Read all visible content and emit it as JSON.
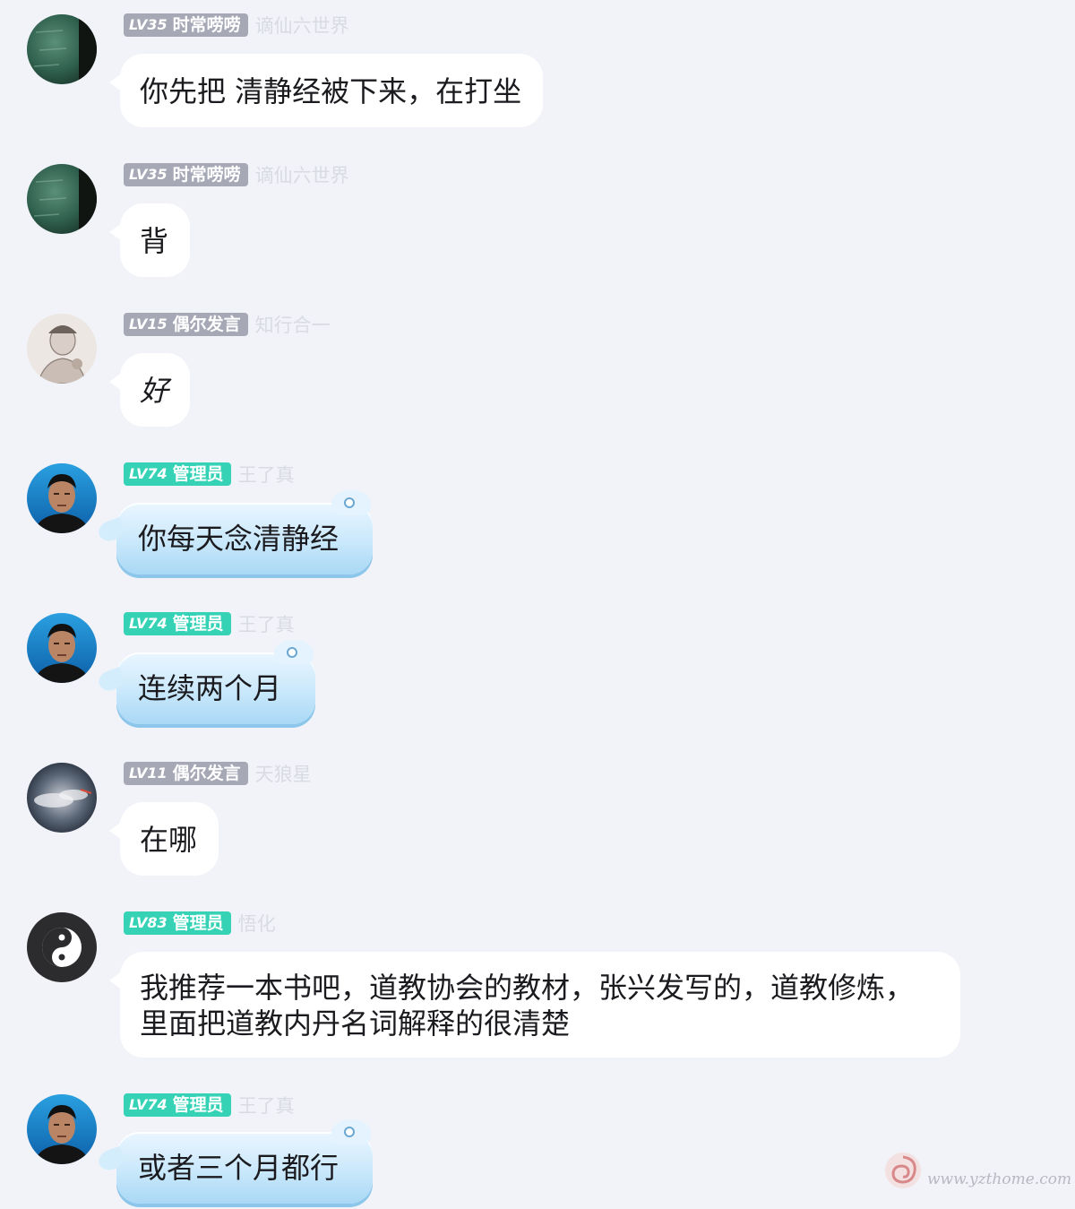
{
  "messages": [
    {
      "level": "LV35",
      "role": "时常唠唠",
      "nickname": "谪仙六世界",
      "text": "你先把 清静经被下来，在打坐",
      "avatar": "green-blackboard-avatar"
    },
    {
      "level": "LV35",
      "role": "时常唠唠",
      "nickname": "谪仙六世界",
      "text": "背",
      "avatar": "green-blackboard-avatar"
    },
    {
      "level": "LV15",
      "role": "偶尔发言",
      "nickname": "知行合一",
      "text": "好",
      "avatar": "sketch-portrait-avatar"
    },
    {
      "level": "LV74",
      "role": "管理员",
      "nickname": "王了真",
      "text": "你每天念清静经",
      "avatar": "man-photo-avatar"
    },
    {
      "level": "LV74",
      "role": "管理员",
      "nickname": "王了真",
      "text": "连续两个月",
      "avatar": "man-photo-avatar"
    },
    {
      "level": "LV11",
      "role": "偶尔发言",
      "nickname": "天狼星",
      "text": "在哪",
      "avatar": "cloudy-sky-avatar"
    },
    {
      "level": "LV83",
      "role": "管理员",
      "nickname": "悟化",
      "text": "我推荐一本书吧，道教协会的教材，张兴发写的，道教修炼，里面把道教内丹名词解释的很清楚",
      "avatar": "taiji-logo-avatar"
    },
    {
      "level": "LV74",
      "role": "管理员",
      "nickname": "王了真",
      "text": "或者三个月都行",
      "avatar": "man-photo-avatar"
    }
  ],
  "watermark": {
    "text": "www.yzthome.com",
    "icon": "swirl-logo-icon"
  },
  "colors": {
    "background": "#f2f3f8",
    "badge_member": "#a6a8b6",
    "badge_admin": "#35d2b6",
    "bubble_blue": "#c9e8fb"
  }
}
